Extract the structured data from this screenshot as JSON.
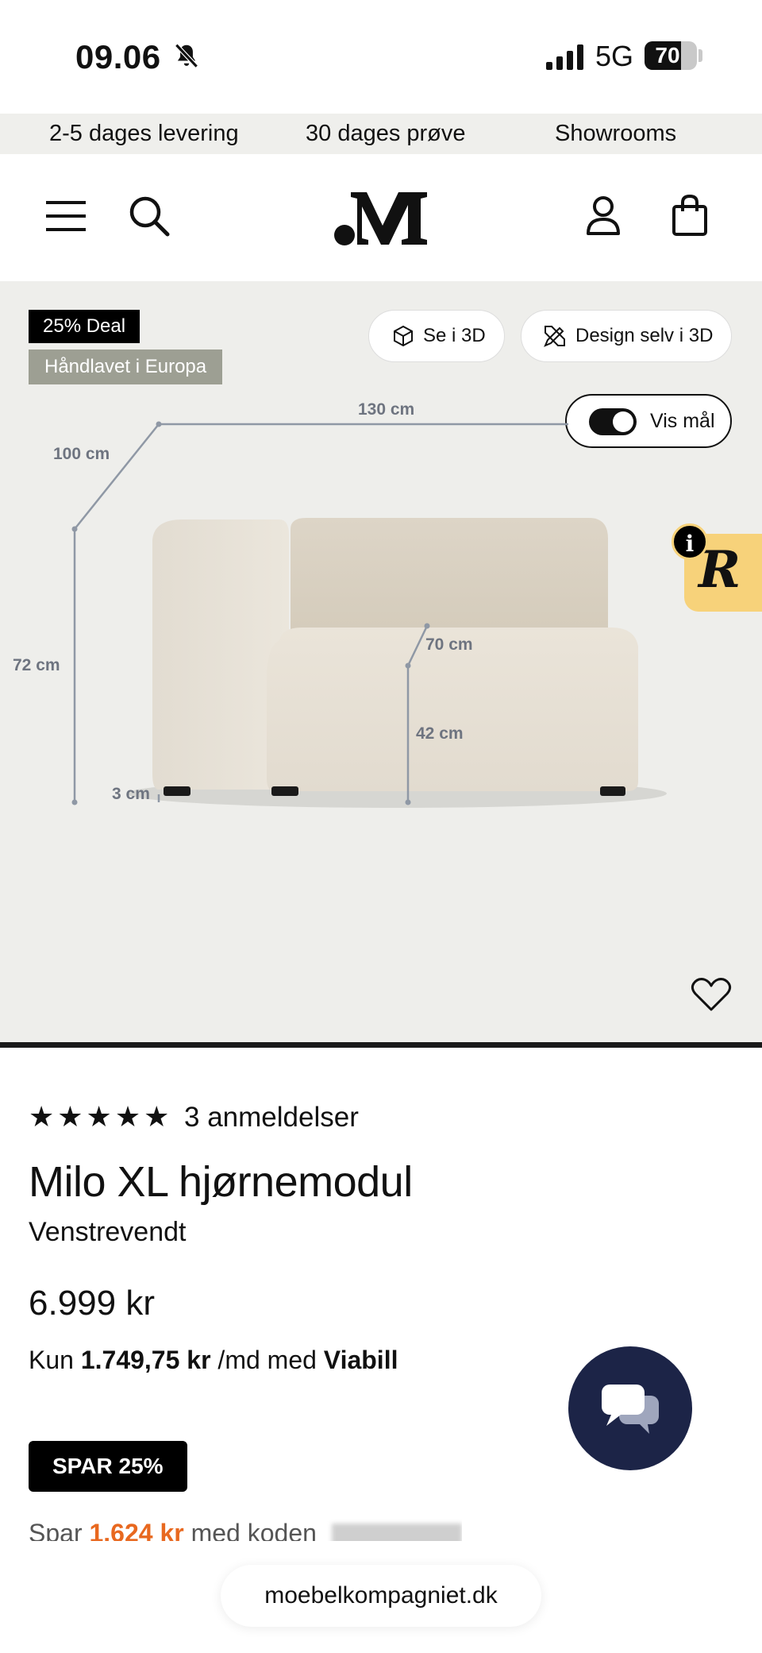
{
  "status_bar": {
    "time": "09.06",
    "network": "5G",
    "battery": "70",
    "battery_level": 0.7
  },
  "usp": [
    "2-5 dages levering",
    "30 dages prøve",
    "Showrooms"
  ],
  "header": {
    "logo": ".M"
  },
  "hero": {
    "badges": [
      "25% Deal",
      "Håndlavet i Europa"
    ],
    "view_3d_label": "Se i 3D",
    "design_3d_label": "Design selv i 3D",
    "show_dimensions_label": "Vis mål",
    "show_dimensions_on": true,
    "dimensions": {
      "width": "130 cm",
      "depth": "100 cm",
      "height": "72 cm",
      "seat_depth": "70 cm",
      "seat_height": "42 cm",
      "leg": "3 cm"
    },
    "widget_letter": "R",
    "info_letter": "i"
  },
  "product": {
    "stars": "★★★★★",
    "reviews": "3 anmeldelser",
    "title": "Milo XL hjørnemodul",
    "variant": "Venstrevendt",
    "price": "6.999 kr",
    "finance_prefix": "Kun",
    "finance_amount": "1.749,75 kr",
    "finance_mid": "/md med",
    "finance_provider": "Viabill",
    "save_badge": "SPAR 25%",
    "save_prefix": "Spar",
    "save_amount": "1.624 kr",
    "save_suffix": "med koden"
  },
  "url": "moebelkompagniet.dk"
}
